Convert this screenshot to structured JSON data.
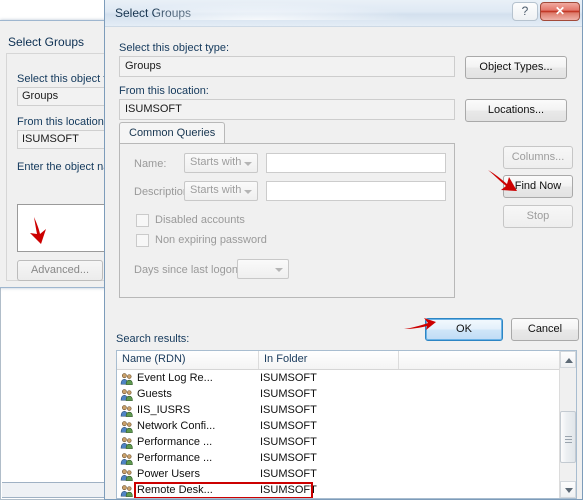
{
  "background_dialog": {
    "title": "Select Groups",
    "object_type_label": "Select this object ty",
    "object_type_value": "Groups",
    "location_label": "From this location:",
    "location_value": "ISUMSOFT",
    "object_names_label": "Enter the object nar",
    "object_names_value": "",
    "advanced_button": "Advanced..."
  },
  "dialog": {
    "title": "Select Groups",
    "help_icon": "question-mark-icon",
    "close_icon": "close-x-icon",
    "object_type_label": "Select this object type:",
    "object_type_value": "Groups",
    "object_types_button": "Object Types...",
    "location_label": "From this location:",
    "location_value": "ISUMSOFT",
    "locations_button": "Locations...",
    "tab_label": "Common Queries",
    "query": {
      "name_label": "Name:",
      "name_operator": "Starts with",
      "name_value": "",
      "description_label": "Description:",
      "description_operator": "Starts with",
      "description_value": "",
      "disabled_accounts_label": "Disabled accounts",
      "disabled_accounts_checked": false,
      "non_expiring_label": "Non expiring password",
      "non_expiring_checked": false,
      "days_since_logon_label": "Days since last logon:",
      "days_since_logon_value": ""
    },
    "columns_button": "Columns...",
    "find_now_button": "Find Now",
    "stop_button": "Stop",
    "search_icon": "magnifier-folder-icon",
    "ok_button": "OK",
    "cancel_button": "Cancel",
    "search_results_label": "Search results:",
    "results": {
      "columns": [
        "Name (RDN)",
        "In Folder",
        ""
      ],
      "rows": [
        {
          "name": "Event Log Re...",
          "folder": "ISUMSOFT",
          "highlighted": false
        },
        {
          "name": "Guests",
          "folder": "ISUMSOFT",
          "highlighted": false
        },
        {
          "name": "IIS_IUSRS",
          "folder": "ISUMSOFT",
          "highlighted": false
        },
        {
          "name": "Network Confi...",
          "folder": "ISUMSOFT",
          "highlighted": false
        },
        {
          "name": "Performance ...",
          "folder": "ISUMSOFT",
          "highlighted": false
        },
        {
          "name": "Performance ...",
          "folder": "ISUMSOFT",
          "highlighted": false
        },
        {
          "name": "Power Users",
          "folder": "ISUMSOFT",
          "highlighted": false
        },
        {
          "name": "Remote Desk...",
          "folder": "ISUMSOFT",
          "highlighted": true
        }
      ]
    }
  },
  "annotations": {
    "arrow_color": "#cc0000",
    "highlight_color": "#cc0000",
    "arrow_advanced": "red-arrow-pointing-to-advanced",
    "arrow_find_now": "red-arrow-pointing-to-find-now",
    "arrow_ok": "red-arrow-pointing-to-ok"
  },
  "colors": {
    "dialog_face": "#f0f0f0",
    "title_text": "#16344f",
    "close_red": "#bb2a18",
    "default_button_blue": "#2c85c4"
  }
}
